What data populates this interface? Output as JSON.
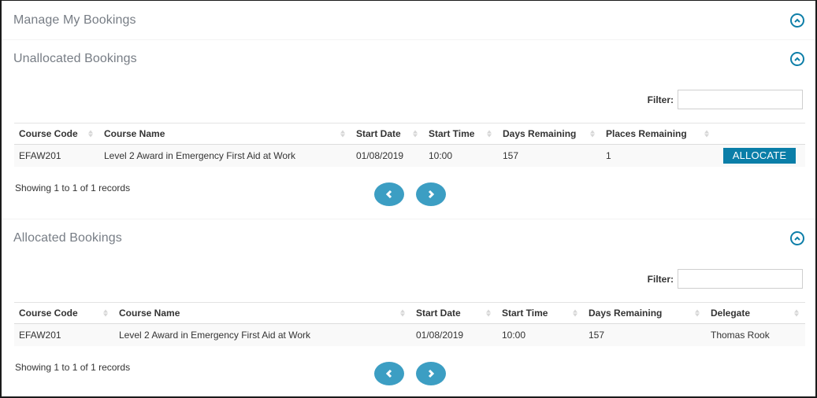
{
  "sections": {
    "manage": {
      "title": "Manage My Bookings"
    },
    "unallocated": {
      "title": "Unallocated Bookings",
      "filter_label": "Filter:",
      "filter_value": "",
      "columns": [
        "Course Code",
        "Course Name",
        "Start Date",
        "Start Time",
        "Days Remaining",
        "Places Remaining",
        ""
      ],
      "rows": [
        {
          "course_code": "EFAW201",
          "course_name": "Level 2 Award in Emergency First Aid at Work",
          "start_date": "01/08/2019",
          "start_time": "10:00",
          "days_remaining": "157",
          "places_remaining": "1",
          "action": "ALLOCATE"
        }
      ],
      "info": "Showing 1 to 1 of 1 records"
    },
    "allocated": {
      "title": "Allocated Bookings",
      "filter_label": "Filter:",
      "filter_value": "",
      "columns": [
        "Course Code",
        "Course Name",
        "Start Date",
        "Start Time",
        "Days Remaining",
        "Delegate"
      ],
      "rows": [
        {
          "course_code": "EFAW201",
          "course_name": "Level 2 Award in Emergency First Aid at Work",
          "start_date": "01/08/2019",
          "start_time": "10:00",
          "days_remaining": "157",
          "delegate": "Thomas Rook"
        }
      ],
      "info": "Showing 1 to 1 of 1 records"
    }
  },
  "icons": {
    "collapse": "chevron-up-circle-icon",
    "prev": "chevron-left-icon",
    "next": "chevron-right-icon",
    "sort": "sort-arrows-icon"
  },
  "colors": {
    "accent": "#0a7ea8",
    "pager": "#3c9ec3",
    "section_title": "#777d85"
  }
}
